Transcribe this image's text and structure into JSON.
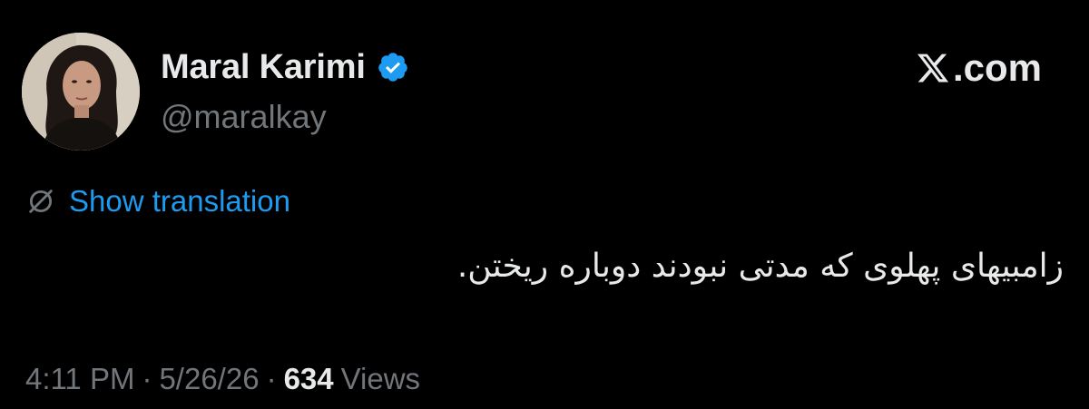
{
  "author": {
    "display_name": "Maral Karimi",
    "handle": "@maralkay",
    "verified": true
  },
  "source_label": ".com",
  "translate": {
    "label": "Show translation"
  },
  "tweet": {
    "text": "زامبیهای پهلوی که مدتی نبودند دوباره ریختن."
  },
  "meta": {
    "time": "4:11 PM",
    "separator": "·",
    "date": "5/26/26",
    "views_count": "634",
    "views_label": "Views"
  },
  "colors": {
    "background": "#000000",
    "primary_text": "#e7e9ea",
    "secondary_text": "#71767b",
    "accent": "#1d9bf0"
  },
  "icons": {
    "verified": "verified-badge-icon",
    "brand": "x-logo-icon",
    "translate": "translate-globe-icon"
  }
}
